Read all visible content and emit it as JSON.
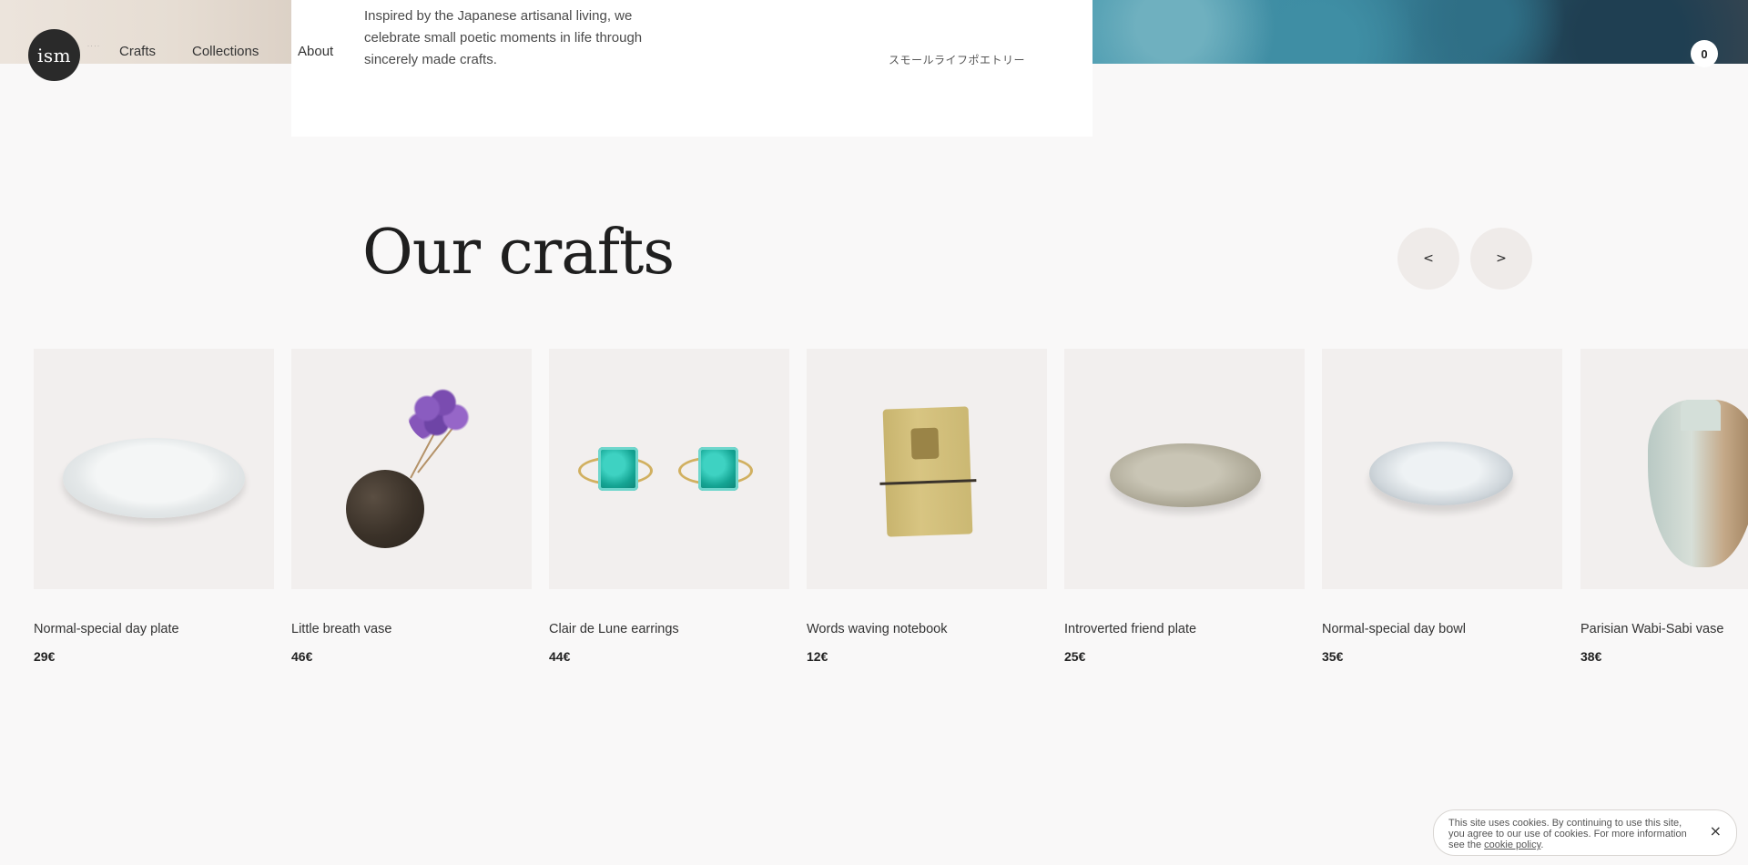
{
  "brand": {
    "logo_text": "ism",
    "logo_sub": "· · · ·"
  },
  "nav": {
    "items": [
      {
        "label": "Crafts"
      },
      {
        "label": "Collections"
      },
      {
        "label": "About"
      }
    ],
    "cart_count": "0"
  },
  "intro": {
    "text": "Inspired by the Japanese artisanal living, we celebrate small poetic moments in life through sincerely made crafts.",
    "jp_tagline": "スモールライフポエトリー"
  },
  "crafts": {
    "title": "Our crafts",
    "prev_label": "<",
    "next_label": ">",
    "products": [
      {
        "name": "Normal-special day plate",
        "price": "29€",
        "icon": "white-plate"
      },
      {
        "name": "Little breath vase",
        "price": "46€",
        "icon": "dark-round-vase-with-lavender"
      },
      {
        "name": "Clair de Lune earrings",
        "price": "44€",
        "icon": "turquoise-earrings"
      },
      {
        "name": "Words waving notebook",
        "price": "12€",
        "icon": "mustard-notebook"
      },
      {
        "name": "Introverted friend plate",
        "price": "25€",
        "icon": "grey-plate"
      },
      {
        "name": "Normal-special day bowl",
        "price": "35€",
        "icon": "white-bowl"
      },
      {
        "name": "Parisian Wabi-Sabi vase",
        "price": "38€",
        "icon": "glazed-vase"
      }
    ]
  },
  "cookie": {
    "text": "This site uses cookies. By continuing to use this site, you agree to our use of cookies. For more information see the ",
    "link": "cookie policy",
    "suffix": ".",
    "close_label": "×"
  },
  "colors": {
    "background": "#f9f8f8",
    "card_bg": "#f2efee",
    "logo_bg": "#2a2a2a",
    "arrow_bg": "#efebe9",
    "text": "#2b2b2b"
  }
}
